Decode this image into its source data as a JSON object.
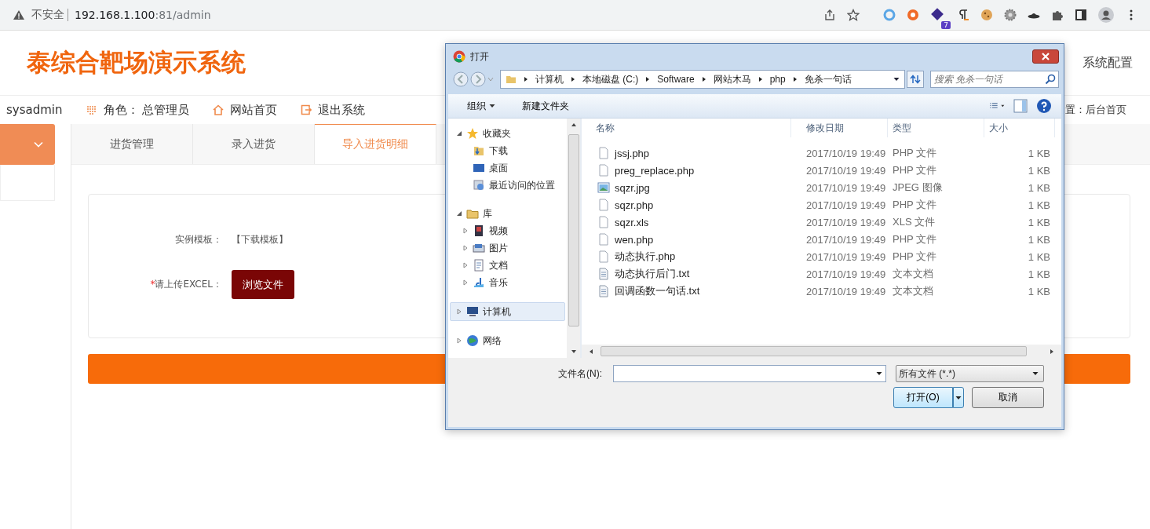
{
  "browser": {
    "security_label": "不安全",
    "url_host": "192.168.1.100",
    "url_path": ":81/admin",
    "extension_badge": "7"
  },
  "header": {
    "title": "泰综合靶场演示系统",
    "right_link": "系统配置"
  },
  "nav": {
    "user": "sysadmin",
    "links": [
      {
        "kind": "role",
        "label": "角色： 总管理员"
      },
      {
        "kind": "home",
        "label": "网站首页"
      },
      {
        "kind": "exit",
        "label": "退出系统"
      }
    ],
    "location": "置：后台首页"
  },
  "tabs": [
    {
      "label": "进货管理",
      "selected": false
    },
    {
      "label": "录入进货",
      "selected": false
    },
    {
      "label": "导入进货明细",
      "selected": true
    }
  ],
  "form": {
    "template_label": "实例模板：",
    "template_link": "【下载模板】",
    "upload_label": "请上传EXCEL：",
    "required_mark": "*",
    "browse_button": "浏览文件"
  },
  "dialog": {
    "title": "打开",
    "path": [
      "计算机",
      "本地磁盘 (C:)",
      "Software",
      "网站木马",
      "php",
      "免杀一句话"
    ],
    "search": {
      "placeholder": "搜索 免杀一句话"
    },
    "toolbar": [
      {
        "label": "组织",
        "dropdown": true
      },
      {
        "label": "新建文件夹",
        "dropdown": false
      }
    ],
    "tree": [
      {
        "kind": "favorites",
        "label": "收藏夹",
        "expanded": true,
        "selected": false,
        "children": [
          {
            "kind": "downloads",
            "label": "下载",
            "selected": false
          },
          {
            "kind": "desktop",
            "label": "桌面",
            "selected": false
          },
          {
            "kind": "recent",
            "label": "最近访问的位置",
            "selected": false
          }
        ]
      },
      {
        "kind": "library",
        "label": "库",
        "expanded": true,
        "selected": false,
        "children": [
          {
            "kind": "video",
            "label": "视频",
            "expanded": false,
            "selected": false
          },
          {
            "kind": "pictures",
            "label": "图片",
            "expanded": false,
            "selected": false
          },
          {
            "kind": "documents",
            "label": "文档",
            "expanded": false,
            "selected": false
          },
          {
            "kind": "music",
            "label": "音乐",
            "expanded": false,
            "selected": false
          }
        ]
      },
      {
        "kind": "computer",
        "label": "计算机",
        "expanded": false,
        "selected": true
      },
      {
        "kind": "network",
        "label": "网络",
        "expanded": false,
        "selected": false
      }
    ],
    "columns": [
      "名称",
      "修改日期",
      "类型",
      "大小"
    ],
    "files": [
      {
        "kind": "file",
        "name": "jssj.php",
        "date": "2017/10/19 19:49",
        "type": "PHP 文件",
        "size": "1 KB"
      },
      {
        "kind": "file",
        "name": "preg_replace.php",
        "date": "2017/10/19 19:49",
        "type": "PHP 文件",
        "size": "1 KB"
      },
      {
        "kind": "image",
        "name": "sqzr.jpg",
        "date": "2017/10/19 19:49",
        "type": "JPEG 图像",
        "size": "1 KB"
      },
      {
        "kind": "file",
        "name": "sqzr.php",
        "date": "2017/10/19 19:49",
        "type": "PHP 文件",
        "size": "1 KB"
      },
      {
        "kind": "file",
        "name": "sqzr.xls",
        "date": "2017/10/19 19:49",
        "type": "XLS 文件",
        "size": "1 KB"
      },
      {
        "kind": "file",
        "name": "wen.php",
        "date": "2017/10/19 19:49",
        "type": "PHP 文件",
        "size": "1 KB"
      },
      {
        "kind": "file",
        "name": "动态执行.php",
        "date": "2017/10/19 19:49",
        "type": "PHP 文件",
        "size": "1 KB"
      },
      {
        "kind": "text",
        "name": "动态执行后门.txt",
        "date": "2017/10/19 19:49",
        "type": "文本文档",
        "size": "1 KB"
      },
      {
        "kind": "text",
        "name": "回调函数一句话.txt",
        "date": "2017/10/19 19:49",
        "type": "文本文档",
        "size": "1 KB"
      }
    ],
    "filename_label": "文件名(N):",
    "filter": "所有文件 (*.*)",
    "open_button": "打开(O)",
    "cancel_button": "取消"
  }
}
